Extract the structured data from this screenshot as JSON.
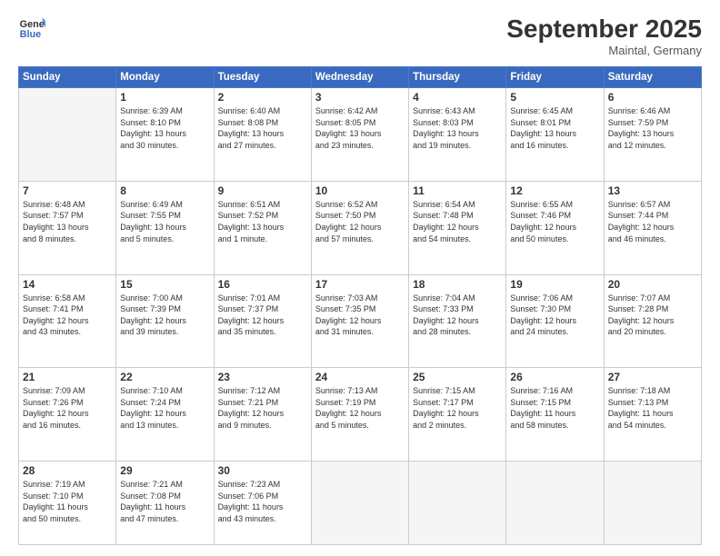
{
  "header": {
    "logo_line1": "General",
    "logo_line2": "Blue",
    "month": "September 2025",
    "location": "Maintal, Germany"
  },
  "weekdays": [
    "Sunday",
    "Monday",
    "Tuesday",
    "Wednesday",
    "Thursday",
    "Friday",
    "Saturday"
  ],
  "weeks": [
    [
      {
        "day": "",
        "content": ""
      },
      {
        "day": "1",
        "content": "Sunrise: 6:39 AM\nSunset: 8:10 PM\nDaylight: 13 hours\nand 30 minutes."
      },
      {
        "day": "2",
        "content": "Sunrise: 6:40 AM\nSunset: 8:08 PM\nDaylight: 13 hours\nand 27 minutes."
      },
      {
        "day": "3",
        "content": "Sunrise: 6:42 AM\nSunset: 8:05 PM\nDaylight: 13 hours\nand 23 minutes."
      },
      {
        "day": "4",
        "content": "Sunrise: 6:43 AM\nSunset: 8:03 PM\nDaylight: 13 hours\nand 19 minutes."
      },
      {
        "day": "5",
        "content": "Sunrise: 6:45 AM\nSunset: 8:01 PM\nDaylight: 13 hours\nand 16 minutes."
      },
      {
        "day": "6",
        "content": "Sunrise: 6:46 AM\nSunset: 7:59 PM\nDaylight: 13 hours\nand 12 minutes."
      }
    ],
    [
      {
        "day": "7",
        "content": "Sunrise: 6:48 AM\nSunset: 7:57 PM\nDaylight: 13 hours\nand 8 minutes."
      },
      {
        "day": "8",
        "content": "Sunrise: 6:49 AM\nSunset: 7:55 PM\nDaylight: 13 hours\nand 5 minutes."
      },
      {
        "day": "9",
        "content": "Sunrise: 6:51 AM\nSunset: 7:52 PM\nDaylight: 13 hours\nand 1 minute."
      },
      {
        "day": "10",
        "content": "Sunrise: 6:52 AM\nSunset: 7:50 PM\nDaylight: 12 hours\nand 57 minutes."
      },
      {
        "day": "11",
        "content": "Sunrise: 6:54 AM\nSunset: 7:48 PM\nDaylight: 12 hours\nand 54 minutes."
      },
      {
        "day": "12",
        "content": "Sunrise: 6:55 AM\nSunset: 7:46 PM\nDaylight: 12 hours\nand 50 minutes."
      },
      {
        "day": "13",
        "content": "Sunrise: 6:57 AM\nSunset: 7:44 PM\nDaylight: 12 hours\nand 46 minutes."
      }
    ],
    [
      {
        "day": "14",
        "content": "Sunrise: 6:58 AM\nSunset: 7:41 PM\nDaylight: 12 hours\nand 43 minutes."
      },
      {
        "day": "15",
        "content": "Sunrise: 7:00 AM\nSunset: 7:39 PM\nDaylight: 12 hours\nand 39 minutes."
      },
      {
        "day": "16",
        "content": "Sunrise: 7:01 AM\nSunset: 7:37 PM\nDaylight: 12 hours\nand 35 minutes."
      },
      {
        "day": "17",
        "content": "Sunrise: 7:03 AM\nSunset: 7:35 PM\nDaylight: 12 hours\nand 31 minutes."
      },
      {
        "day": "18",
        "content": "Sunrise: 7:04 AM\nSunset: 7:33 PM\nDaylight: 12 hours\nand 28 minutes."
      },
      {
        "day": "19",
        "content": "Sunrise: 7:06 AM\nSunset: 7:30 PM\nDaylight: 12 hours\nand 24 minutes."
      },
      {
        "day": "20",
        "content": "Sunrise: 7:07 AM\nSunset: 7:28 PM\nDaylight: 12 hours\nand 20 minutes."
      }
    ],
    [
      {
        "day": "21",
        "content": "Sunrise: 7:09 AM\nSunset: 7:26 PM\nDaylight: 12 hours\nand 16 minutes."
      },
      {
        "day": "22",
        "content": "Sunrise: 7:10 AM\nSunset: 7:24 PM\nDaylight: 12 hours\nand 13 minutes."
      },
      {
        "day": "23",
        "content": "Sunrise: 7:12 AM\nSunset: 7:21 PM\nDaylight: 12 hours\nand 9 minutes."
      },
      {
        "day": "24",
        "content": "Sunrise: 7:13 AM\nSunset: 7:19 PM\nDaylight: 12 hours\nand 5 minutes."
      },
      {
        "day": "25",
        "content": "Sunrise: 7:15 AM\nSunset: 7:17 PM\nDaylight: 12 hours\nand 2 minutes."
      },
      {
        "day": "26",
        "content": "Sunrise: 7:16 AM\nSunset: 7:15 PM\nDaylight: 11 hours\nand 58 minutes."
      },
      {
        "day": "27",
        "content": "Sunrise: 7:18 AM\nSunset: 7:13 PM\nDaylight: 11 hours\nand 54 minutes."
      }
    ],
    [
      {
        "day": "28",
        "content": "Sunrise: 7:19 AM\nSunset: 7:10 PM\nDaylight: 11 hours\nand 50 minutes."
      },
      {
        "day": "29",
        "content": "Sunrise: 7:21 AM\nSunset: 7:08 PM\nDaylight: 11 hours\nand 47 minutes."
      },
      {
        "day": "30",
        "content": "Sunrise: 7:23 AM\nSunset: 7:06 PM\nDaylight: 11 hours\nand 43 minutes."
      },
      {
        "day": "",
        "content": ""
      },
      {
        "day": "",
        "content": ""
      },
      {
        "day": "",
        "content": ""
      },
      {
        "day": "",
        "content": ""
      }
    ]
  ]
}
